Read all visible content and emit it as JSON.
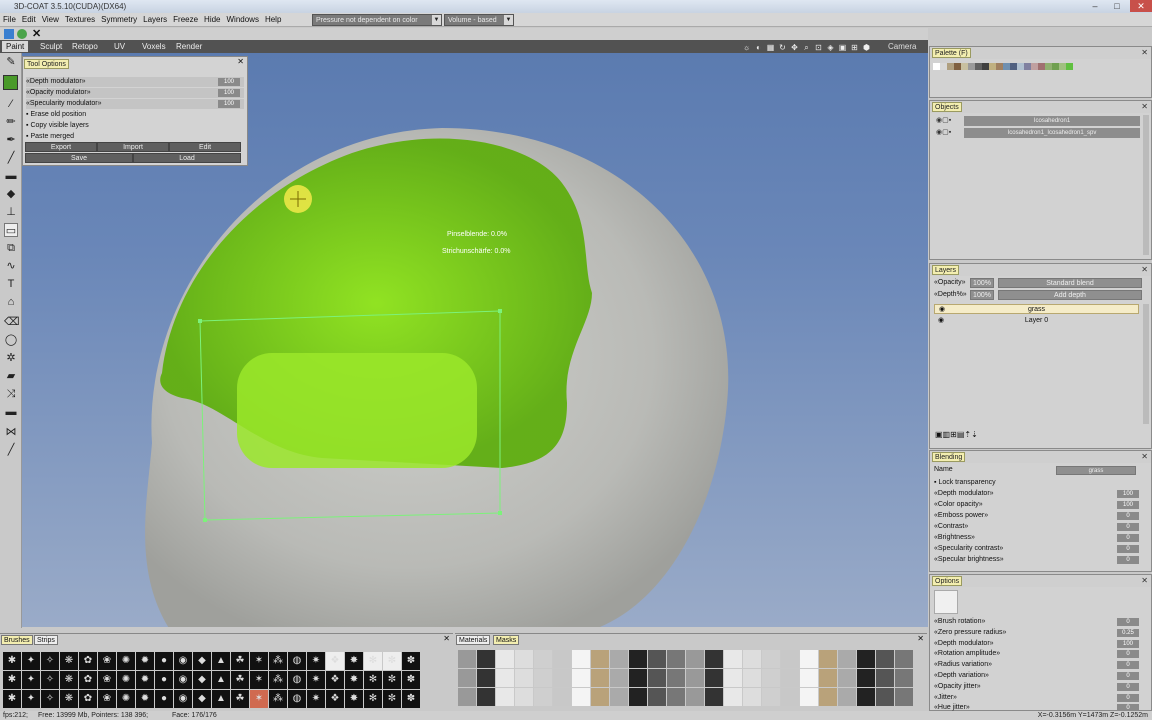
{
  "window": {
    "title": "3D-COAT 3.5.10(CUDA)(DX64)"
  },
  "menu": [
    "File",
    "Edit",
    "View",
    "Textures",
    "Symmetry",
    "Layers",
    "Freeze",
    "Hide",
    "Windows",
    "Help"
  ],
  "combos": {
    "pressure": "Pressure not dependent on color",
    "volume": "Volume - based"
  },
  "tabs": [
    "Paint",
    "Sculpt",
    "Retopo",
    "UV",
    "Voxels",
    "Render"
  ],
  "camera_label": "Camera",
  "tool_options": {
    "title": "Tool Options",
    "rows": [
      {
        "label": "«Depth modulator»",
        "value": "100"
      },
      {
        "label": "«Opacity modulator»",
        "value": "100"
      },
      {
        "label": "«Specularity modulator»",
        "value": "100"
      }
    ],
    "checks": [
      "Erase old position",
      "Copy visible layers",
      "Paste merged"
    ],
    "buttons_row1": [
      "Export",
      "Import",
      "Edit"
    ],
    "buttons_row2": [
      "Save",
      "Load"
    ]
  },
  "viewport": {
    "overlay1": "Pinselblende: 0.0%",
    "overlay2": "Strichunschärfe: 0.0%"
  },
  "palette": {
    "title": "Palette (F)",
    "colors": [
      "#ffffff",
      "#d9d9d9",
      "#b0a080",
      "#806040",
      "#c8c0a0",
      "#9a9a9a",
      "#606060",
      "#404040",
      "#c0b080",
      "#a08060",
      "#7090b0",
      "#506080",
      "#b0c0d0",
      "#8080a0",
      "#c0a0a0",
      "#a07070",
      "#90b070",
      "#70a050",
      "#a0c080",
      "#60c040"
    ]
  },
  "objects": {
    "title": "Objects",
    "items": [
      "Icosahedron1",
      "Icosahedron1_Icosahedron1_spv"
    ]
  },
  "layers": {
    "title": "Layers",
    "opacity_label": "«Opacity»",
    "opacity_value": "100%",
    "blend": "Standard blend",
    "depth_label": "«Depth%»",
    "depth_value": "100%",
    "depth_mode": "Add depth",
    "items": [
      "grass",
      "Layer 0"
    ]
  },
  "blending": {
    "title": "Blending",
    "name_label": "Name",
    "name_value": "grass",
    "lock": "Lock transparency",
    "rows": [
      {
        "label": "«Depth modulator»",
        "value": "100"
      },
      {
        "label": "«Color opacity»",
        "value": "100"
      },
      {
        "label": "«Emboss power»",
        "value": "0"
      },
      {
        "label": "«Contrast»",
        "value": "0"
      },
      {
        "label": "«Brightness»",
        "value": "0"
      },
      {
        "label": "«Specularity contrast»",
        "value": "0"
      },
      {
        "label": "«Specular brightness»",
        "value": "0"
      }
    ]
  },
  "options": {
    "title": "Options",
    "rows": [
      {
        "label": "«Brush rotation»",
        "value": "0"
      },
      {
        "label": "«Zero pressure radius»",
        "value": "0.25"
      },
      {
        "label": "«Depth modulator»",
        "value": "100"
      },
      {
        "label": "«Rotation amplitude»",
        "value": "0"
      },
      {
        "label": "«Radius variation»",
        "value": "0"
      },
      {
        "label": "«Depth variation»",
        "value": "0"
      },
      {
        "label": "«Opacity jitter»",
        "value": "0"
      },
      {
        "label": "«Jitter»",
        "value": "0"
      },
      {
        "label": "«Hue jitter»",
        "value": "0"
      }
    ]
  },
  "bottom": {
    "brushes_tab": "Brushes",
    "strips_tab": "Strips",
    "materials_tab": "Materials",
    "masks_tab": "Masks"
  },
  "status": {
    "fps": "fps:212;",
    "mem": "Free: 13999 Mb, Pointers: 138 396;",
    "faces": "Face: 176/176",
    "coords": "X=-0.3156m Y=1473m Z=-0.1252m"
  },
  "colors": {
    "accent": "#8ddc1c",
    "viewport_top": "#5b7bb0",
    "panel_title": "#f3eeb0"
  }
}
